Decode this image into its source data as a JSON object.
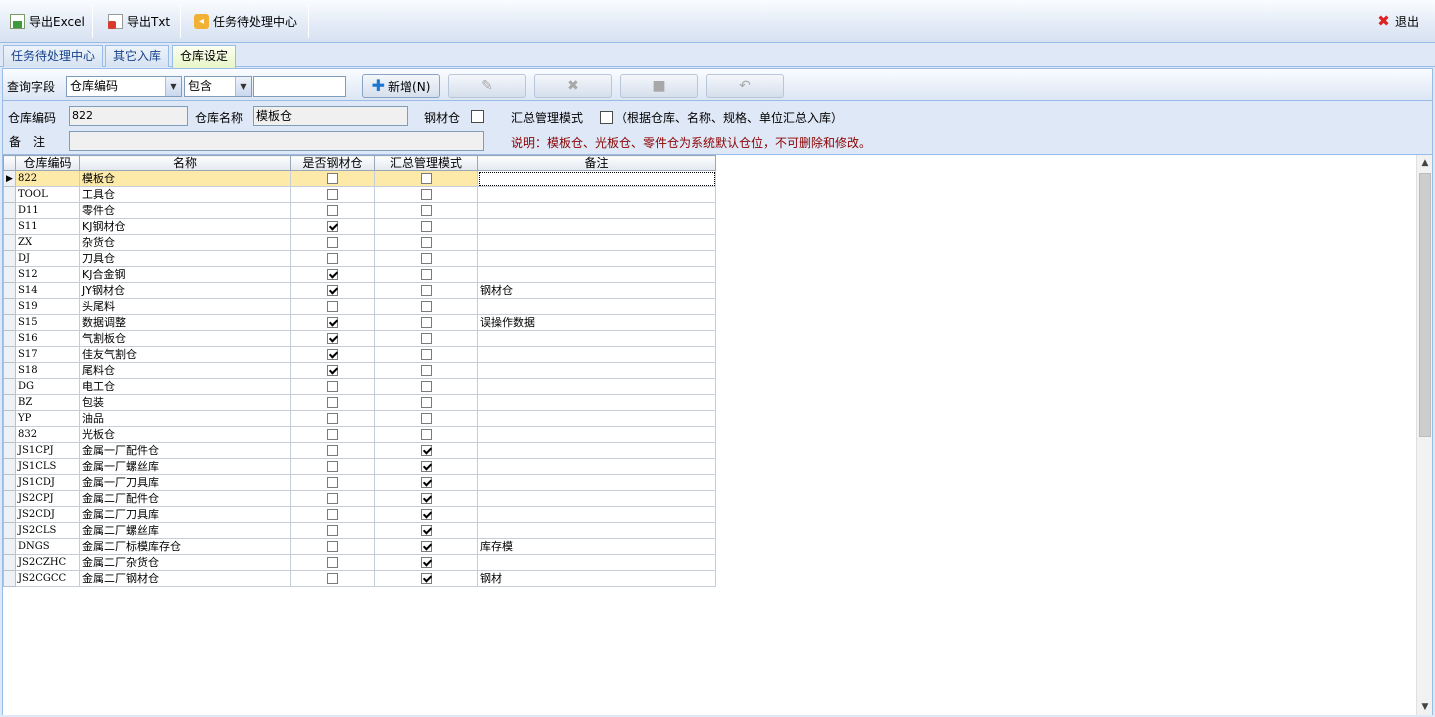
{
  "toolbar": {
    "export_excel": "导出Excel",
    "export_txt": "导出Txt",
    "task_center": "任务待处理中心",
    "exit": "退出"
  },
  "tabs": [
    {
      "label": "任务待处理中心",
      "active": false
    },
    {
      "label": "其它入库",
      "active": false
    },
    {
      "label": "仓库设定",
      "active": true
    }
  ],
  "query": {
    "field_label": "查询字段",
    "field_value": "仓库编码",
    "operator_value": "包含",
    "search_value": "",
    "new_button": "新增(N)"
  },
  "form": {
    "code_label": "仓库编码",
    "code_value": "822",
    "name_label": "仓库名称",
    "name_value": "模板仓",
    "steel_label": "钢材仓",
    "summary_label": "汇总管理模式",
    "summary_hint": "（根据仓库、名称、规格、单位汇总入库）",
    "remark_label": "备　注",
    "remark_value": "",
    "note": "说明：模板仓、光板仓、零件仓为系统默认仓位，不可删除和修改。"
  },
  "grid": {
    "columns": [
      "仓库编码",
      "名称",
      "是否钢材仓",
      "汇总管理模式",
      "备注"
    ],
    "rows": [
      {
        "code": "822",
        "name": "模板仓",
        "steel": false,
        "summary": false,
        "remark": ""
      },
      {
        "code": "TOOL",
        "name": "工具仓",
        "steel": false,
        "summary": false,
        "remark": ""
      },
      {
        "code": "D11",
        "name": "零件仓",
        "steel": false,
        "summary": false,
        "remark": ""
      },
      {
        "code": "S11",
        "name": "KJ钢材仓",
        "steel": true,
        "summary": false,
        "remark": ""
      },
      {
        "code": "ZX",
        "name": "杂货仓",
        "steel": false,
        "summary": false,
        "remark": ""
      },
      {
        "code": "DJ",
        "name": "刀具仓",
        "steel": false,
        "summary": false,
        "remark": ""
      },
      {
        "code": "S12",
        "name": "KJ合金钢",
        "steel": true,
        "summary": false,
        "remark": ""
      },
      {
        "code": "S14",
        "name": "JY钢材仓",
        "steel": true,
        "summary": false,
        "remark": "钢材仓"
      },
      {
        "code": "S19",
        "name": "头尾料",
        "steel": false,
        "summary": false,
        "remark": ""
      },
      {
        "code": "S15",
        "name": "数据调整",
        "steel": true,
        "summary": false,
        "remark": "误操作数据"
      },
      {
        "code": "S16",
        "name": "气割板仓",
        "steel": true,
        "summary": false,
        "remark": ""
      },
      {
        "code": "S17",
        "name": "佳友气割仓",
        "steel": true,
        "summary": false,
        "remark": ""
      },
      {
        "code": "S18",
        "name": "尾料仓",
        "steel": true,
        "summary": false,
        "remark": ""
      },
      {
        "code": "DG",
        "name": "电工仓",
        "steel": false,
        "summary": false,
        "remark": ""
      },
      {
        "code": "BZ",
        "name": "包装",
        "steel": false,
        "summary": false,
        "remark": ""
      },
      {
        "code": "YP",
        "name": "油品",
        "steel": false,
        "summary": false,
        "remark": ""
      },
      {
        "code": "832",
        "name": "光板仓",
        "steel": false,
        "summary": false,
        "remark": ""
      },
      {
        "code": "JS1CPJ",
        "name": "金属一厂配件仓",
        "steel": false,
        "summary": true,
        "remark": ""
      },
      {
        "code": "JS1CLS",
        "name": "金属一厂螺丝库",
        "steel": false,
        "summary": true,
        "remark": ""
      },
      {
        "code": "JS1CDJ",
        "name": "金属一厂刀具库",
        "steel": false,
        "summary": true,
        "remark": ""
      },
      {
        "code": "JS2CPJ",
        "name": "金属二厂配件仓",
        "steel": false,
        "summary": true,
        "remark": ""
      },
      {
        "code": "JS2CDJ",
        "name": "金属二厂刀具库",
        "steel": false,
        "summary": true,
        "remark": ""
      },
      {
        "code": "JS2CLS",
        "name": "金属二厂螺丝库",
        "steel": false,
        "summary": true,
        "remark": ""
      },
      {
        "code": "DNGS",
        "name": "金属二厂标模库存仓",
        "steel": false,
        "summary": true,
        "remark": "库存模"
      },
      {
        "code": "JS2CZHC",
        "name": "金属二厂杂货仓",
        "steel": false,
        "summary": true,
        "remark": ""
      },
      {
        "code": "JS2CGCC",
        "name": "金属二厂钢材仓",
        "steel": false,
        "summary": true,
        "remark": "钢材"
      }
    ]
  }
}
